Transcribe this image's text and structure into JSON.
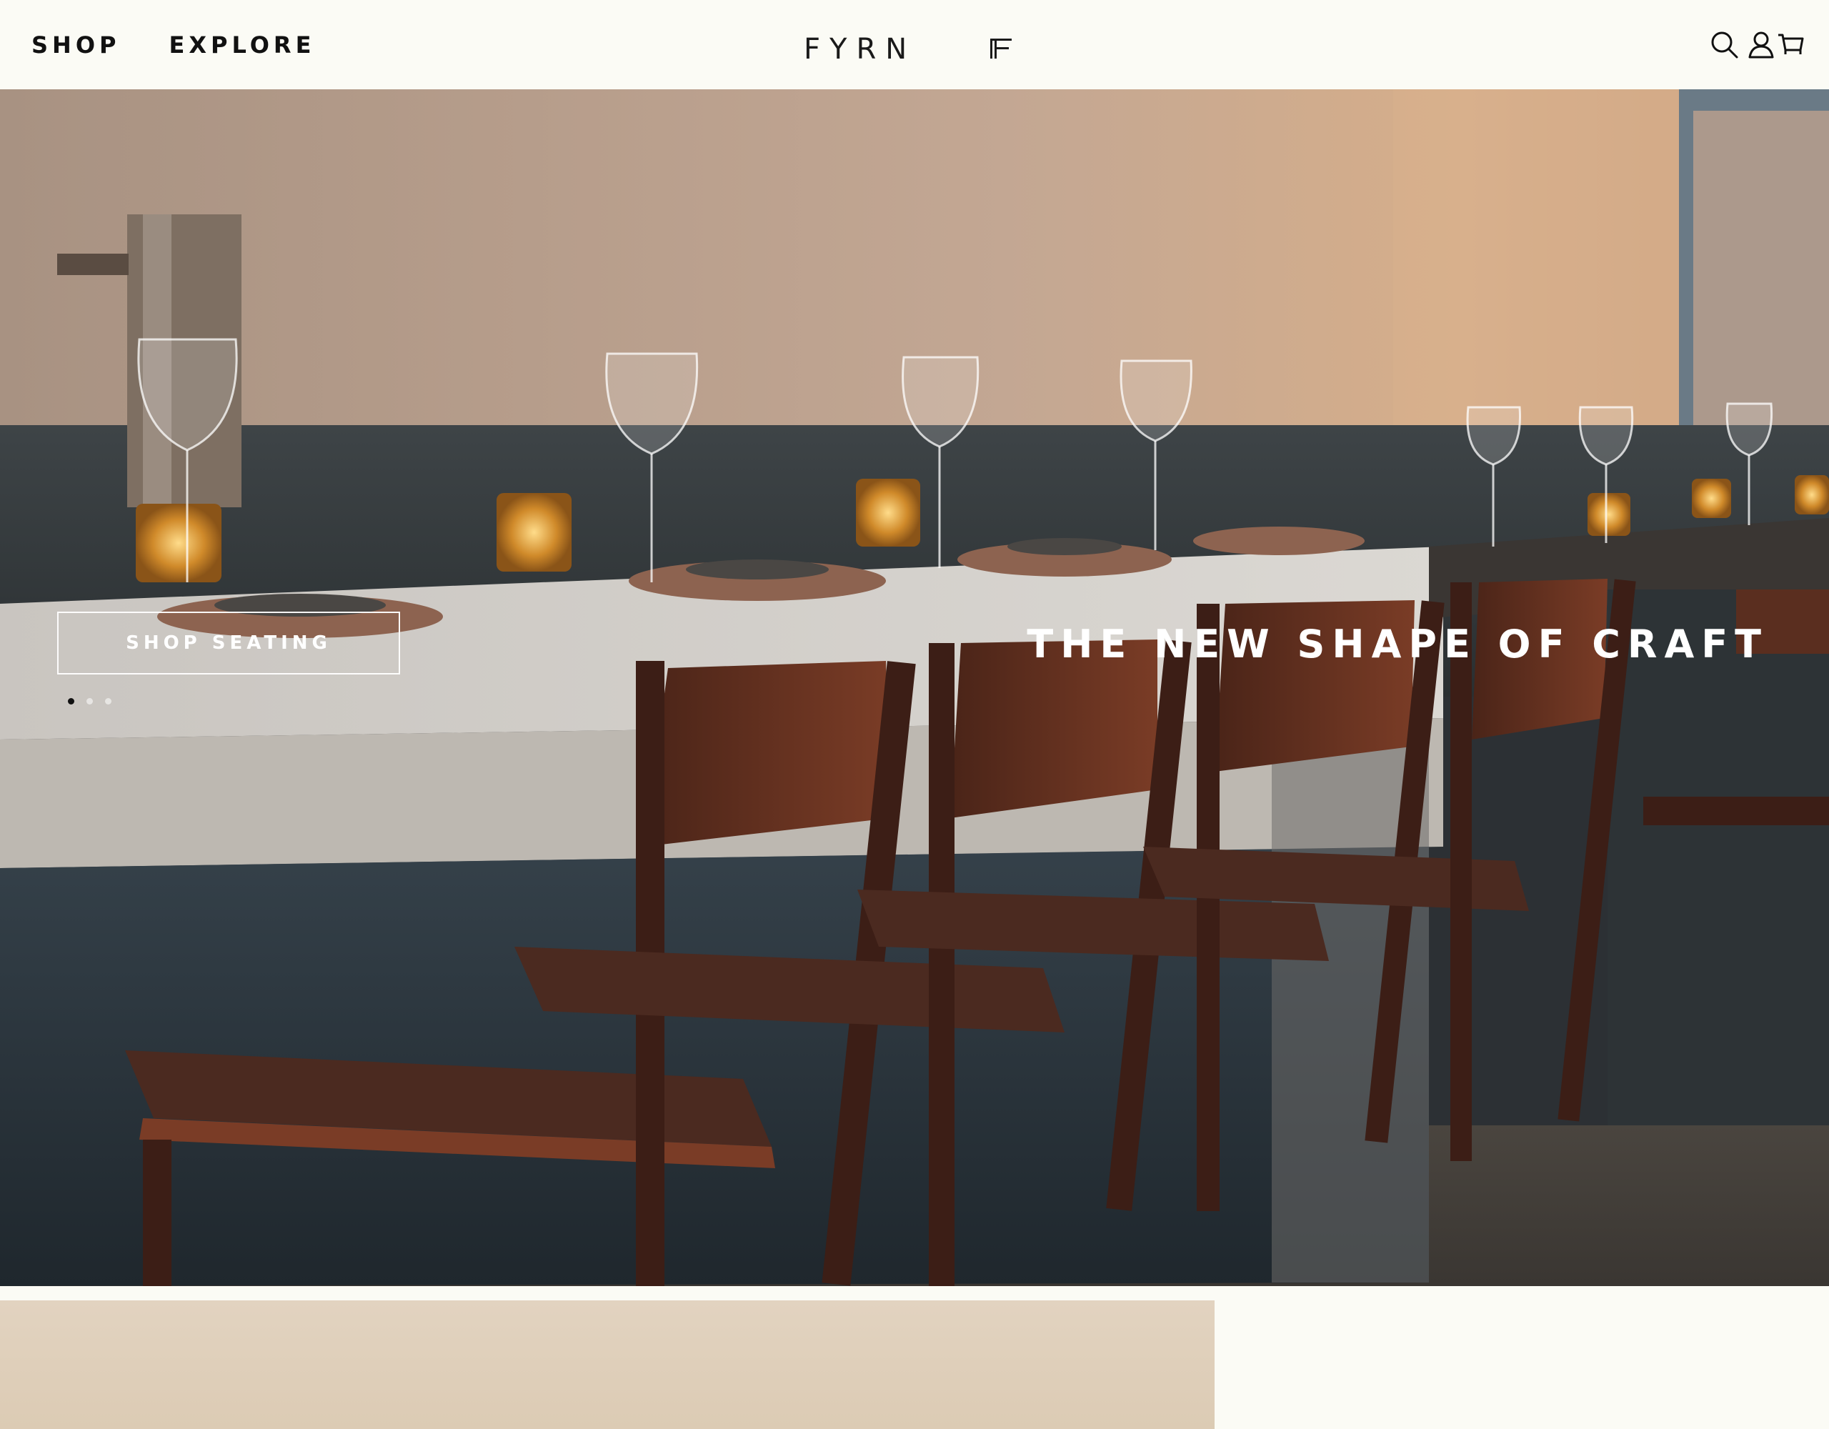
{
  "header": {
    "nav": [
      {
        "label": "SHOP"
      },
      {
        "label": "EXPLORE"
      }
    ],
    "brand": "FYRN",
    "icons": [
      "search-icon",
      "account-icon",
      "cart-icon"
    ]
  },
  "hero": {
    "cta_label": "SHOP SEATING",
    "tagline": "THE NEW SHAPE OF CRAFT",
    "slide_count": 3,
    "active_slide": 1
  },
  "colors": {
    "background": "#fbfbf5",
    "text": "#111111",
    "hero_text": "#ffffff"
  }
}
